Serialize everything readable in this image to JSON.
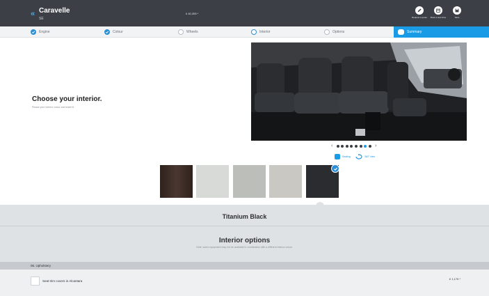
{
  "header": {
    "model_title": "Caravelle",
    "model_sub": "SE",
    "price": "£ 40,305 *",
    "tools": [
      {
        "icon": "pencil-icon",
        "label": "Request a quote"
      },
      {
        "icon": "calendar-icon",
        "label": "Book a test drive"
      },
      {
        "icon": "save-icon",
        "label": "Save"
      }
    ]
  },
  "steps": [
    {
      "label": "Engine",
      "state": "done"
    },
    {
      "label": "Colour",
      "state": "done"
    },
    {
      "label": "Wheels",
      "state": "open"
    },
    {
      "label": "Interior",
      "state": "current"
    },
    {
      "label": "Options",
      "state": "open"
    },
    {
      "label": "Summary",
      "state": "summary"
    }
  ],
  "main": {
    "heading": "Choose your interior.",
    "subheading": "Please your interior colour and trade lit.",
    "views": {
      "seating": "Seating",
      "view360": "360° view"
    },
    "carousel": {
      "count": 8,
      "active": 7
    }
  },
  "swatches": [
    {
      "name": "brown-leather",
      "color": "#3b2a24",
      "selected": false
    },
    {
      "name": "light-grey-fabric",
      "color": "#d6d8d6",
      "selected": false
    },
    {
      "name": "grey-fabric",
      "color": "#b9bbb8",
      "selected": false
    },
    {
      "name": "stone-fabric",
      "color": "#c7c5c0",
      "selected": false
    },
    {
      "name": "titanium-black",
      "color": "#2a2c2f",
      "selected": true
    }
  ],
  "selected_color_name": "Titanium Black",
  "options": {
    "title": "Interior options",
    "subtitle": "Note: some equipment may not be available in combination with a different interior colour.",
    "group": "06. Upholstery",
    "items": [
      {
        "label": "Seat trim covers in Alcantara",
        "price": "£ 1,176 *",
        "checked": false
      }
    ]
  },
  "colors": {
    "accent": "#1a9be6",
    "topbar": "#3c4046",
    "panel": "#dfe2e5"
  }
}
